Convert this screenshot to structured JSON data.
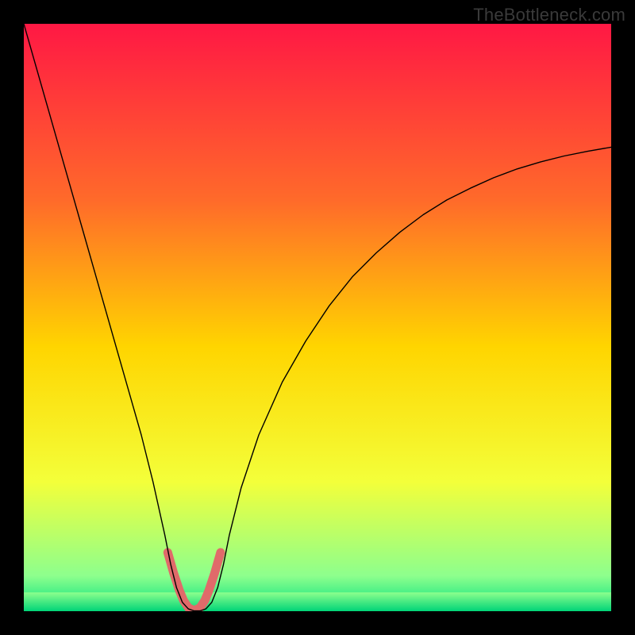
{
  "watermark": "TheBottleneck.com",
  "chart_data": {
    "type": "line",
    "title": "",
    "xlabel": "",
    "ylabel": "",
    "xlim": [
      0,
      100
    ],
    "ylim": [
      0,
      100
    ],
    "grid": false,
    "legend": false,
    "background_gradient": {
      "top": "#ff1844",
      "mid_top": "#ff6a2a",
      "mid": "#ffd500",
      "mid_bottom": "#f3ff3a",
      "near_bottom": "#8dff8d",
      "bottom": "#00e07f"
    },
    "series": [
      {
        "name": "curve",
        "color": "#000000",
        "stroke_width": 1.4,
        "x": [
          0,
          2,
          4,
          6,
          8,
          10,
          12,
          14,
          16,
          18,
          20,
          22,
          24,
          25,
          26,
          27,
          28,
          29,
          30,
          31,
          32,
          33,
          34,
          35,
          37,
          40,
          44,
          48,
          52,
          56,
          60,
          64,
          68,
          72,
          76,
          80,
          84,
          88,
          92,
          96,
          100
        ],
        "y": [
          100,
          93,
          86,
          79,
          72,
          65,
          58,
          51,
          44,
          37,
          30,
          22,
          13,
          8,
          4,
          1.5,
          0.4,
          0.05,
          0.05,
          0.4,
          1.5,
          4,
          8,
          13,
          21,
          30,
          39,
          46,
          52,
          57,
          61,
          64.5,
          67.5,
          70,
          72,
          73.8,
          75.3,
          76.5,
          77.5,
          78.3,
          79
        ]
      },
      {
        "name": "dip-highlight",
        "color": "#e06a6a",
        "stroke_width": 11,
        "x": [
          24.5,
          25.5,
          26.5,
          27.2,
          28,
          29,
          30,
          30.8,
          31.5,
          32.5,
          33.5
        ],
        "y": [
          10,
          6.5,
          3.5,
          1.8,
          0.6,
          0.1,
          0.6,
          1.8,
          3.5,
          6.5,
          10
        ]
      }
    ],
    "bottom_band": {
      "from_y": 0,
      "to_y": 3.2,
      "color_top": "#8dff8d",
      "color_bottom": "#00d478"
    }
  }
}
